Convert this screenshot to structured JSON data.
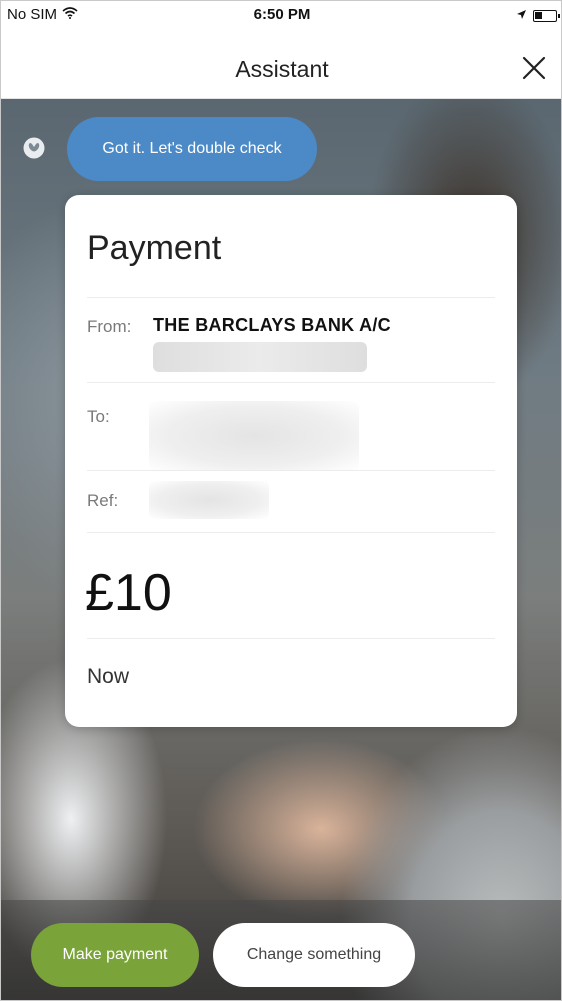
{
  "status_bar": {
    "carrier": "No SIM",
    "time": "6:50 PM"
  },
  "nav": {
    "title": "Assistant",
    "close_icon": "close-icon"
  },
  "chat": {
    "message": "Got it. Let's double check",
    "bot_icon": "bot-avatar-icon"
  },
  "payment_card": {
    "title": "Payment",
    "from_label": "From:",
    "from_value": "THE BARCLAYS BANK A/C",
    "to_label": "To:",
    "ref_label": "Ref:",
    "amount": "£10",
    "when": "Now"
  },
  "actions": {
    "primary_label": "Make payment",
    "secondary_label": "Change something"
  },
  "colors": {
    "chat_bubble": "#4b8ac6",
    "primary_button": "#7aa33a",
    "secondary_button": "#ffffff"
  }
}
